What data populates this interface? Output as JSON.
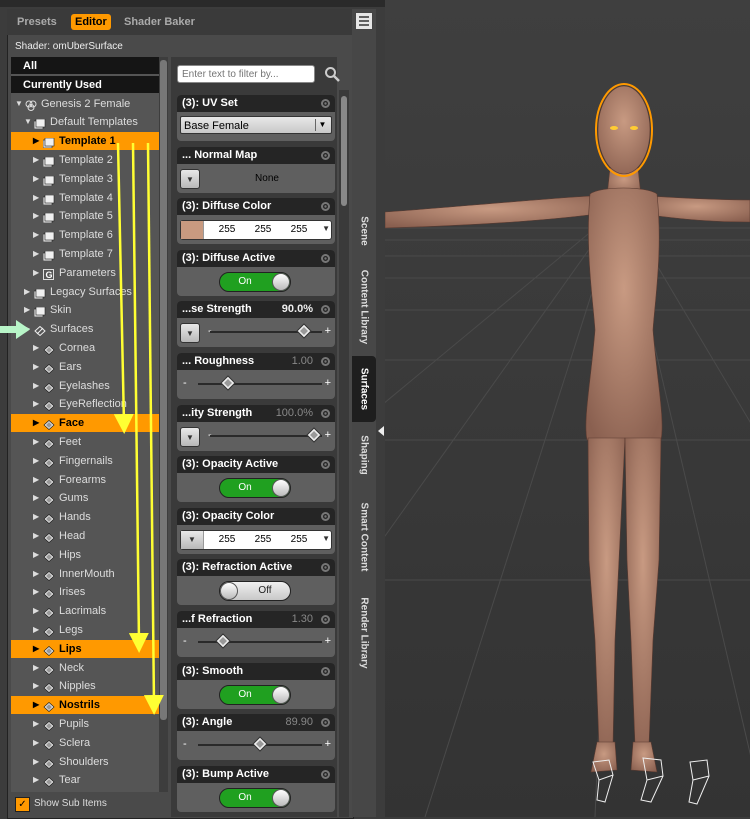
{
  "tabs": [
    "Presets",
    "Editor",
    "Shader Baker"
  ],
  "active_tab": "Editor",
  "shader_label": "Shader: omUberSurface",
  "tree": {
    "items": [
      {
        "label": "All",
        "style": "black",
        "indent": 0,
        "arrow": "",
        "icon": "none"
      },
      {
        "label": "Currently Used",
        "style": "black",
        "indent": 0,
        "arrow": "",
        "icon": "none"
      },
      {
        "label": "Genesis 2 Female",
        "style": "normal",
        "indent": 0,
        "arrow": "down",
        "icon": "figure-icon"
      },
      {
        "label": "Default Templates",
        "style": "normal",
        "indent": 1,
        "arrow": "down",
        "icon": "folder-icon"
      },
      {
        "label": "Template 1",
        "style": "hl",
        "indent": 2,
        "arrow": "right",
        "icon": "folder-icon"
      },
      {
        "label": "Template 2",
        "style": "normal",
        "indent": 2,
        "arrow": "right",
        "icon": "folder-icon"
      },
      {
        "label": "Template 3",
        "style": "normal",
        "indent": 2,
        "arrow": "right",
        "icon": "folder-icon"
      },
      {
        "label": "Template 4",
        "style": "normal",
        "indent": 2,
        "arrow": "right",
        "icon": "folder-icon"
      },
      {
        "label": "Template 5",
        "style": "normal",
        "indent": 2,
        "arrow": "right",
        "icon": "folder-icon"
      },
      {
        "label": "Template 6",
        "style": "normal",
        "indent": 2,
        "arrow": "right",
        "icon": "folder-icon"
      },
      {
        "label": "Template 7",
        "style": "normal",
        "indent": 2,
        "arrow": "right",
        "icon": "folder-icon"
      },
      {
        "label": "Parameters",
        "style": "normal",
        "indent": 2,
        "arrow": "right",
        "icon": "g-icon"
      },
      {
        "label": "Legacy Surfaces",
        "style": "normal",
        "indent": 1,
        "arrow": "right",
        "icon": "folder-icon"
      },
      {
        "label": "Skin",
        "style": "normal",
        "indent": 1,
        "arrow": "right",
        "icon": "folder-icon"
      },
      {
        "label": "Surfaces",
        "style": "normal",
        "indent": 1,
        "arrow": "right",
        "icon": "surface-group-icon"
      },
      {
        "label": "Cornea",
        "style": "normal",
        "indent": 2,
        "arrow": "right",
        "icon": "surface-icon"
      },
      {
        "label": "Ears",
        "style": "normal",
        "indent": 2,
        "arrow": "right",
        "icon": "surface-icon"
      },
      {
        "label": "Eyelashes",
        "style": "normal",
        "indent": 2,
        "arrow": "right",
        "icon": "surface-icon"
      },
      {
        "label": "EyeReflection",
        "style": "normal",
        "indent": 2,
        "arrow": "right",
        "icon": "surface-icon"
      },
      {
        "label": "Face",
        "style": "hl",
        "indent": 2,
        "arrow": "right",
        "icon": "surface-icon"
      },
      {
        "label": "Feet",
        "style": "normal",
        "indent": 2,
        "arrow": "right",
        "icon": "surface-icon"
      },
      {
        "label": "Fingernails",
        "style": "normal",
        "indent": 2,
        "arrow": "right",
        "icon": "surface-icon"
      },
      {
        "label": "Forearms",
        "style": "normal",
        "indent": 2,
        "arrow": "right",
        "icon": "surface-icon"
      },
      {
        "label": "Gums",
        "style": "normal",
        "indent": 2,
        "arrow": "right",
        "icon": "surface-icon"
      },
      {
        "label": "Hands",
        "style": "normal",
        "indent": 2,
        "arrow": "right",
        "icon": "surface-icon"
      },
      {
        "label": "Head",
        "style": "normal",
        "indent": 2,
        "arrow": "right",
        "icon": "surface-icon"
      },
      {
        "label": "Hips",
        "style": "normal",
        "indent": 2,
        "arrow": "right",
        "icon": "surface-icon"
      },
      {
        "label": "InnerMouth",
        "style": "normal",
        "indent": 2,
        "arrow": "right",
        "icon": "surface-icon"
      },
      {
        "label": "Irises",
        "style": "normal",
        "indent": 2,
        "arrow": "right",
        "icon": "surface-icon"
      },
      {
        "label": "Lacrimals",
        "style": "normal",
        "indent": 2,
        "arrow": "right",
        "icon": "surface-icon"
      },
      {
        "label": "Legs",
        "style": "normal",
        "indent": 2,
        "arrow": "right",
        "icon": "surface-icon"
      },
      {
        "label": "Lips",
        "style": "hl",
        "indent": 2,
        "arrow": "right",
        "icon": "surface-icon"
      },
      {
        "label": "Neck",
        "style": "normal",
        "indent": 2,
        "arrow": "right",
        "icon": "surface-icon"
      },
      {
        "label": "Nipples",
        "style": "normal",
        "indent": 2,
        "arrow": "right",
        "icon": "surface-icon"
      },
      {
        "label": "Nostrils",
        "style": "hl",
        "indent": 2,
        "arrow": "right",
        "icon": "surface-icon"
      },
      {
        "label": "Pupils",
        "style": "normal",
        "indent": 2,
        "arrow": "right",
        "icon": "surface-icon"
      },
      {
        "label": "Sclera",
        "style": "normal",
        "indent": 2,
        "arrow": "right",
        "icon": "surface-icon"
      },
      {
        "label": "Shoulders",
        "style": "normal",
        "indent": 2,
        "arrow": "right",
        "icon": "surface-icon"
      },
      {
        "label": "Tear",
        "style": "normal",
        "indent": 2,
        "arrow": "right",
        "icon": "surface-icon"
      }
    ]
  },
  "show_sub_items": {
    "label": "Show Sub Items",
    "checked": true
  },
  "filter": {
    "placeholder": "Enter text to filter by..."
  },
  "properties": [
    {
      "title": "(3): UV Set",
      "kind": "dropdown",
      "value": "Base Female",
      "shown_value": ""
    },
    {
      "title": "... Normal Map",
      "kind": "map",
      "value": "None",
      "shown_value": ""
    },
    {
      "title": "(3): Diffuse Color",
      "kind": "color",
      "rgb": [
        "255",
        "255",
        "255"
      ],
      "shown_value": ""
    },
    {
      "title": "(3): Diffuse Active",
      "kind": "toggle",
      "state": "On",
      "shown_value": ""
    },
    {
      "title": "...se Strength",
      "kind": "slider-map",
      "shown_value": "90.0%",
      "fraction": 0.9,
      "dim": false
    },
    {
      "title": "... Roughness",
      "kind": "slider",
      "shown_value": "1.00",
      "fraction": 0.2,
      "dim": true
    },
    {
      "title": "...ity Strength",
      "kind": "slider-map",
      "shown_value": "100.0%",
      "fraction": 1.0,
      "dim": true
    },
    {
      "title": "(3): Opacity Active",
      "kind": "toggle",
      "state": "On",
      "shown_value": ""
    },
    {
      "title": "(3): Opacity Color",
      "kind": "color-map",
      "rgb": [
        "255",
        "255",
        "255"
      ],
      "shown_value": ""
    },
    {
      "title": "(3): Refraction Active",
      "kind": "toggle",
      "state": "Off",
      "shown_value": ""
    },
    {
      "title": "...f Refraction",
      "kind": "slider",
      "shown_value": "1.30",
      "fraction": 0.16,
      "dim": true
    },
    {
      "title": "(3): Smooth",
      "kind": "toggle",
      "state": "On",
      "shown_value": ""
    },
    {
      "title": "(3): Angle",
      "kind": "slider",
      "shown_value": "89.90",
      "fraction": 0.5,
      "dim": true
    },
    {
      "title": "(3): Bump Active",
      "kind": "toggle",
      "state": "On",
      "shown_value": ""
    }
  ],
  "side_tabs": [
    "Scene",
    "Content Library",
    "Surfaces",
    "Shaping",
    "Smart Content",
    "Render Library"
  ],
  "active_side_tab": "Surfaces",
  "colors": {
    "accent": "#ff9900",
    "toggle_on": "#20a020",
    "annotation_arrow": "#ffff33",
    "pointer_arrow": "#b8f5c8"
  }
}
